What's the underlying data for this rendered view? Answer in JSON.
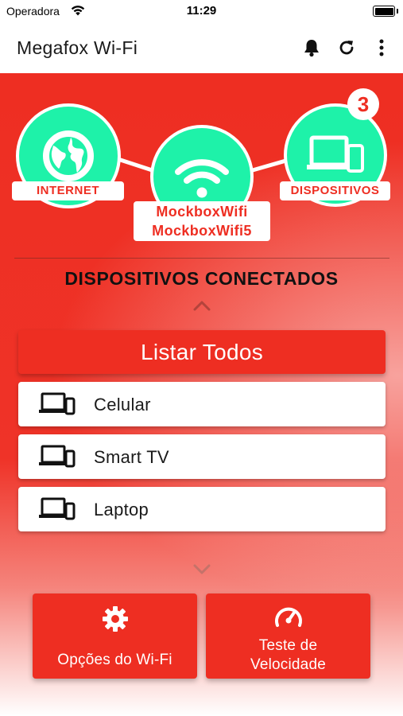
{
  "status_bar": {
    "carrier": "Operadora",
    "time": "11:29"
  },
  "app_bar": {
    "title": "Megafox Wi-Fi"
  },
  "network": {
    "internet_label": "INTERNET",
    "devices_label": "DISPOSITIVOS",
    "devices_count": "3",
    "wifi_networks": [
      "MockboxWifi",
      "MockboxWifi5"
    ]
  },
  "section_title": "DISPOSITIVOS CONECTADOS",
  "list_all_label": "Listar Todos",
  "devices": [
    {
      "label": "Celular"
    },
    {
      "label": "Smart TV"
    },
    {
      "label": "Laptop"
    }
  ],
  "actions": {
    "wifi_options_label": "Opções do Wi-Fi",
    "speed_test_label": "Teste de Velocidade"
  },
  "colors": {
    "primary": "#ee2e22",
    "accent": "#1ef2a9"
  }
}
